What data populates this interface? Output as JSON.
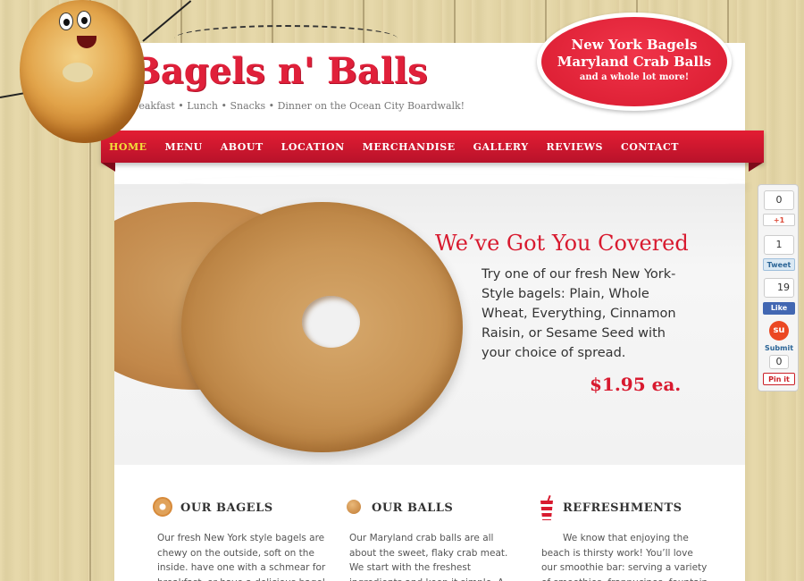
{
  "brand": {
    "logo": "Bagels n' Balls",
    "tagline": "Breakfast • Lunch • Snacks • Dinner on the Ocean City Boardwalk!"
  },
  "badge": {
    "line1": "New York Bagels",
    "line2": "Maryland Crab Balls",
    "line3": "and a whole lot more!"
  },
  "nav": {
    "items": [
      "HOME",
      "MENU",
      "ABOUT",
      "LOCATION",
      "MERCHANDISE",
      "GALLERY",
      "REVIEWS",
      "CONTACT"
    ],
    "active": "HOME"
  },
  "hero": {
    "title": "We’ve Got You Covered",
    "body": "Try one of our fresh New York-Style bagels: Plain, Whole Wheat, Everything, Cinnamon Raisin, or Sesame Seed with your choice of spread.",
    "price": "$1.95 ea."
  },
  "social": {
    "gplus_count": "0",
    "gplus_label": "+1",
    "tweet_count": "1",
    "tweet_label": "Tweet",
    "like_count": "19",
    "like_label": "Like",
    "submit_label": "Submit",
    "pin_count": "0",
    "pin_label": "Pin it"
  },
  "columns": [
    {
      "title": "OUR BAGELS",
      "text": "Our fresh New York style bagels are chewy on the outside, soft on the inside. have one with a schmear for breakfast, or have a delicious bagel"
    },
    {
      "title": "OUR BALLS",
      "text": "Our Maryland crab balls are all about the sweet, flaky crab meat. We start with the freshest ingredients and keep it simple. A classic treat on the"
    },
    {
      "title": "REFRESHMENTS",
      "text": "We know that enjoying the beach is thirsty work! You’ll love our smoothie bar: serving a variety of smoothies, frappucinos, fountain and"
    }
  ],
  "colors": {
    "brand_red": "#e0203a",
    "nav_active": "#f2e03a"
  }
}
